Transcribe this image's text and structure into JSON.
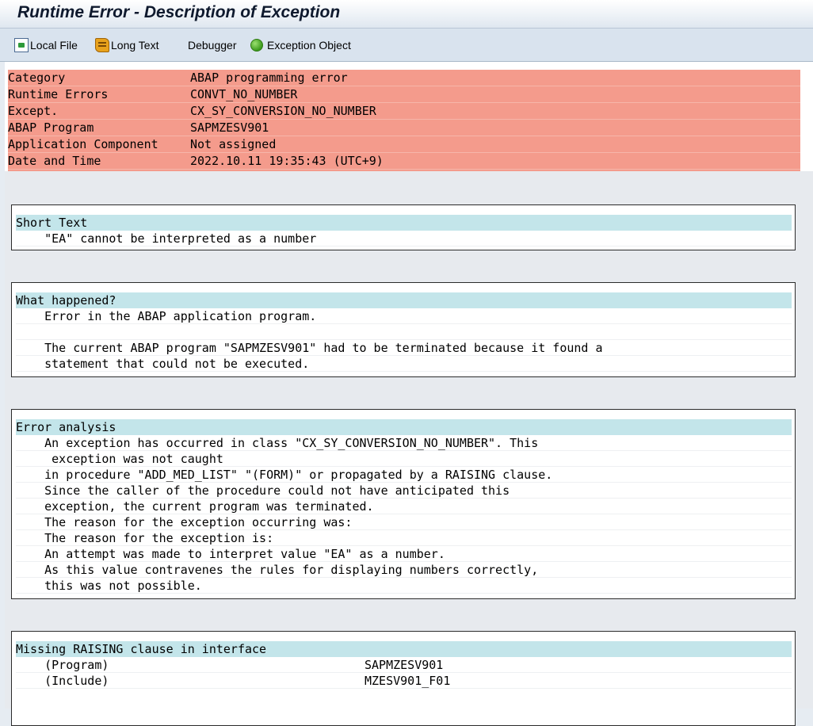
{
  "window": {
    "title": "Runtime Error - Description of Exception"
  },
  "toolbar": {
    "local_file": "Local File",
    "long_text": "Long Text",
    "debugger": "Debugger",
    "exception_object": "Exception Object"
  },
  "header": {
    "rows": [
      {
        "label": "Category",
        "value": "ABAP programming error"
      },
      {
        "label": "Runtime Errors",
        "value": "CONVT_NO_NUMBER"
      },
      {
        "label": "Except.",
        "value": "CX_SY_CONVERSION_NO_NUMBER"
      },
      {
        "label": "ABAP Program",
        "value": "SAPMZESV901"
      },
      {
        "label": "Application Component",
        "value": "Not assigned"
      },
      {
        "label": "Date and Time",
        "value": "2022.10.11 19:35:43 (UTC+9)"
      }
    ]
  },
  "sections": {
    "short_text": {
      "title": "Short Text",
      "lines": [
        "    \"EA\" cannot be interpreted as a number"
      ]
    },
    "what_happened": {
      "title": "What happened?",
      "lines": [
        "    Error in the ABAP application program.",
        "",
        "    The current ABAP program \"SAPMZESV901\" had to be terminated because it found a",
        "    statement that could not be executed."
      ]
    },
    "error_analysis": {
      "title": "Error analysis",
      "lines": [
        "    An exception has occurred in class \"CX_SY_CONVERSION_NO_NUMBER\". This",
        "     exception was not caught",
        "    in procedure \"ADD_MED_LIST\" \"(FORM)\" or propagated by a RAISING clause.",
        "    Since the caller of the procedure could not have anticipated this",
        "    exception, the current program was terminated.",
        "    The reason for the exception occurring was:",
        "    The reason for the exception is:",
        "    An attempt was made to interpret value \"EA\" as a number.",
        "    As this value contravenes the rules for displaying numbers correctly,",
        "    this was not possible."
      ]
    },
    "missing_raising": {
      "title": "Missing RAISING clause in interface",
      "rows": [
        {
          "label": "    (Program)",
          "value": "SAPMZESV901"
        },
        {
          "label": "    (Include)",
          "value": "MZESV901_F01"
        }
      ]
    }
  },
  "colors": {
    "header_bg": "#f49b8c",
    "section_header_bg": "#c3e5ea",
    "exception_icon": "#3c9a1c"
  }
}
